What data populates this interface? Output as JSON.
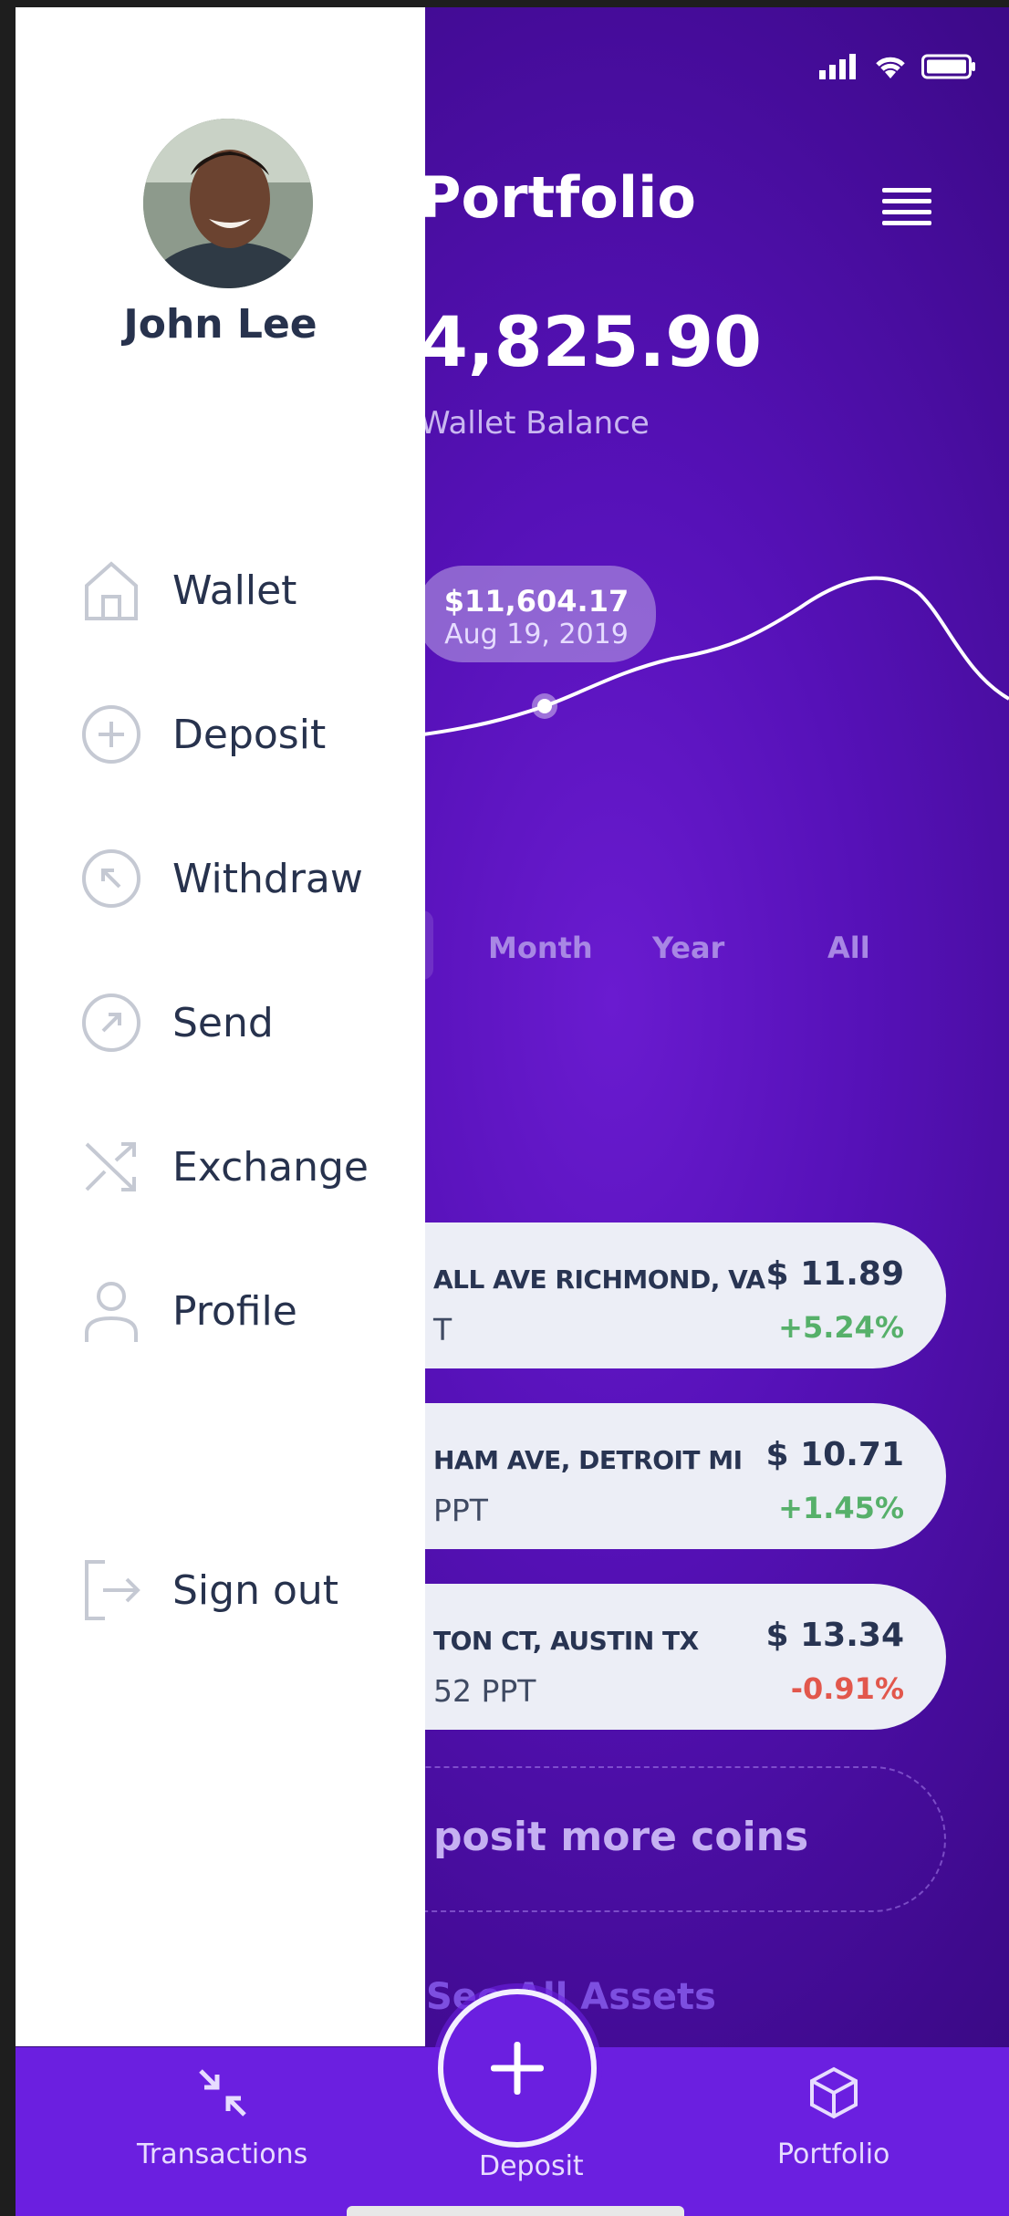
{
  "screen": {
    "title": "Portfolio",
    "balance": "4,825.90",
    "balance_label": "Wallet Balance"
  },
  "chart_tooltip": {
    "value": "$11,604.17",
    "date": "Aug 19, 2019"
  },
  "ranges": [
    "Month",
    "Year",
    "All"
  ],
  "assets": [
    {
      "address": "ALL AVE RICHMOND, VA",
      "sub": "T",
      "price": "$ 11.89",
      "change": "+5.24%",
      "trend": "up"
    },
    {
      "address": "HAM AVE, DETROIT MI",
      "sub": "PPT",
      "price": "$ 10.71",
      "change": "+1.45%",
      "trend": "up"
    },
    {
      "address": "TON CT, AUSTIN TX",
      "sub": "52 PPT",
      "price": "$ 13.34",
      "change": "-0.91%",
      "trend": "down"
    }
  ],
  "deposit_more": "posit more coins",
  "see_all": "See All Assets",
  "bottom_nav": {
    "transactions": "Transactions",
    "deposit": "Deposit",
    "portfolio": "Portfolio"
  },
  "drawer": {
    "user_name": "John Lee",
    "items": [
      {
        "label": "Wallet",
        "icon": "home-icon"
      },
      {
        "label": "Deposit",
        "icon": "plus-circle-icon"
      },
      {
        "label": "Withdraw",
        "icon": "arrow-up-left-circle-icon"
      },
      {
        "label": "Send",
        "icon": "arrow-up-right-circle-icon"
      },
      {
        "label": "Exchange",
        "icon": "shuffle-icon"
      },
      {
        "label": "Profile",
        "icon": "user-icon"
      }
    ],
    "sign_out": "Sign out"
  },
  "colors": {
    "purple": "#6b1fe0",
    "positive": "#56b06a",
    "negative": "#e2574c",
    "text_dark": "#27324d"
  }
}
